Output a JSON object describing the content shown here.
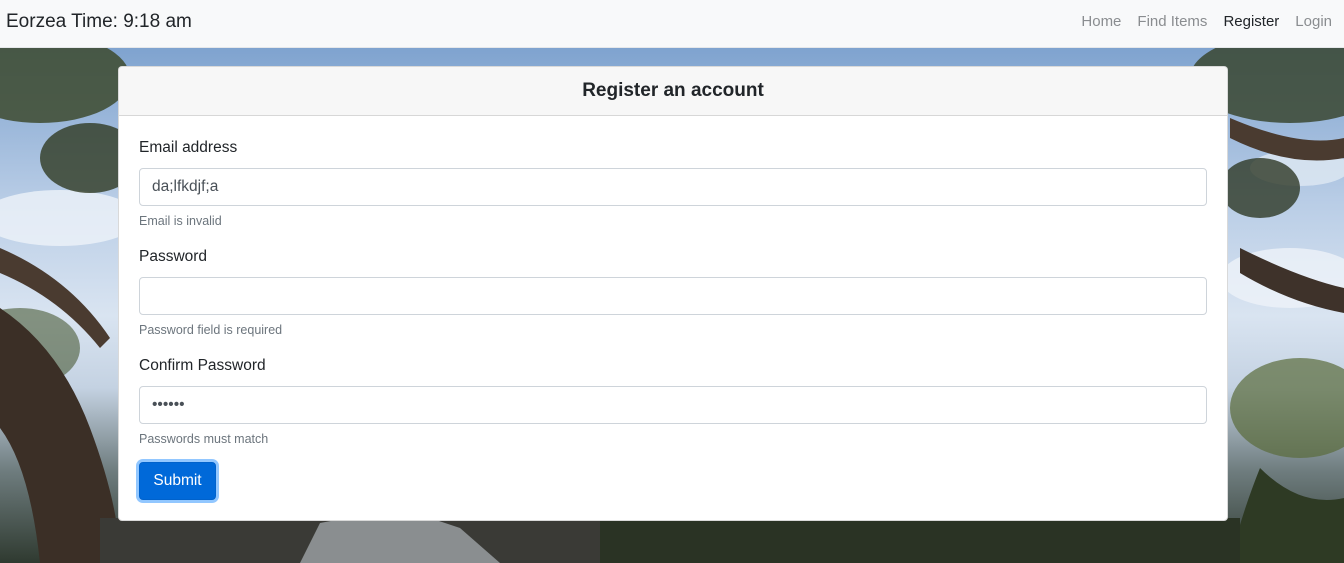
{
  "navbar": {
    "brand": "Eorzea Time: 9:18 am",
    "links": [
      {
        "label": "Home",
        "active": false
      },
      {
        "label": "Find Items",
        "active": false
      },
      {
        "label": "Register",
        "active": true
      },
      {
        "label": "Login",
        "active": false
      }
    ]
  },
  "card": {
    "title": "Register an account"
  },
  "form": {
    "email": {
      "label": "Email address",
      "value": "da;lfkdjf;a",
      "help": "Email is invalid"
    },
    "password": {
      "label": "Password",
      "value": "",
      "help": "Password field is required"
    },
    "confirm": {
      "label": "Confirm Password",
      "value": "aaaaaa",
      "help": "Passwords must match"
    },
    "submit_label": "Submit"
  },
  "colors": {
    "primary": "#0069d9",
    "navbar_bg": "#f8f9fa",
    "muted_text": "#6c757d"
  }
}
